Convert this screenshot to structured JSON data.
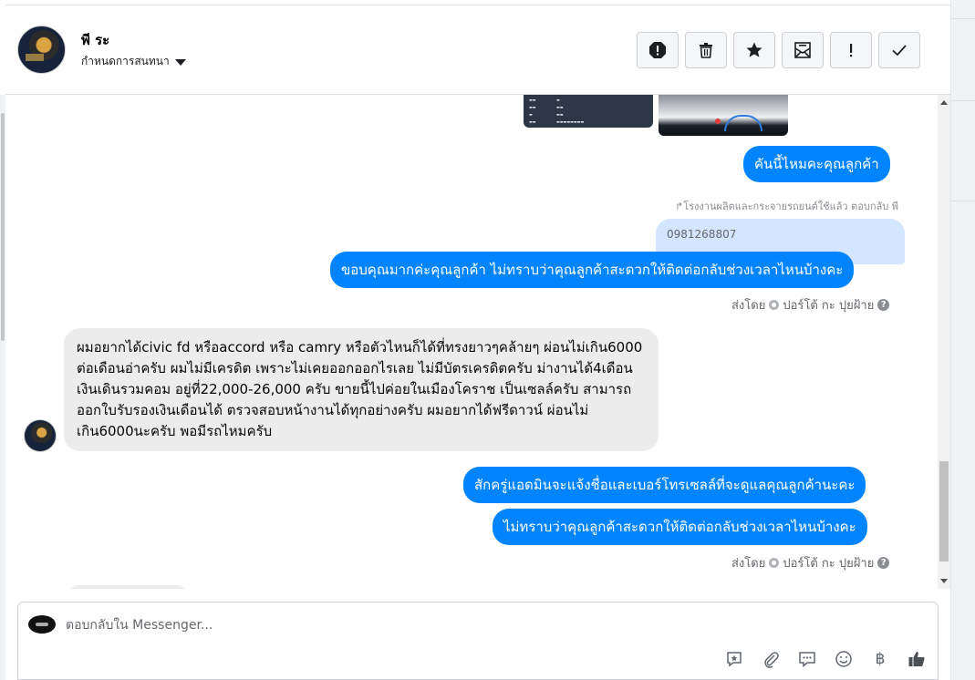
{
  "header": {
    "contact_name": "พี ระ",
    "assign_label": "กำหนดการสนทนา",
    "tools": [
      {
        "name": "report-icon"
      },
      {
        "name": "trash-icon"
      },
      {
        "name": "star-icon"
      },
      {
        "name": "mark-unread-icon"
      },
      {
        "name": "important-icon"
      },
      {
        "name": "check-icon"
      }
    ]
  },
  "messages": {
    "out_1": "คันนี้ไหมคะคุณลูกค้า",
    "reply_label": "โรงงานผลิตและกระจายรถยนต์ใช้แล้ว ตอบกลับ พี",
    "reply_quote": "0981268807",
    "out_2": "ขอบคุณมากค่ะคุณลูกค้า ไม่ทราบว่าคุณลูกค้าสะดวกให้ติดต่อกลับช่วงเวลาไหนบ้างคะ",
    "sent_by_1": "ส่งโดย",
    "sender_1": "ปอร์โต้ กะ ปุยฝ้าย",
    "in_1": "ผมอยากได้civic fd หรือaccord หรือ camry หรือตัวไหนก็ได้ที่ทรงยาวๆคล้ายๆ  ผ่อนไม่เกิน6000 ต่อเดือนอ่าครับ  ผมไม่มีเครดิต เพราะไม่เคยออกออกไรเลย ไม่มีบัตรเครดิตครับ  ม่างานได้4เดือน  เงินเดินรวมคอม อยู่ที่22,000-26,000 ครับ ขายนี้ไปค่อยในเมืองโคราช  เป็นเซลล์ครับ  สามารถออกใบรับรองเงินเดือนได้  ตรวจสอบหน้างานได้ทุกอย่างครับ  ผมอยากได้ฟรีดาวน์ ผ่อนไม่เกิน6000นะครับ  พอมีรถไหมครับ",
    "out_3": "สักครู่แอดมินจะแจ้งชื่อและเบอร์โทรเซลล์ที่จะดูแลคุณลูกค้านะคะ",
    "out_4": "ไม่ทราบว่าคุณลูกค้าสะดวกให้ติดต่อกลับช่วงเวลาไหนบ้างคะ",
    "sent_by_2": "ส่งโดย",
    "sender_2": "ปอร์โต้ กะ ปุยฝ้าย"
  },
  "composer": {
    "placeholder": "ตอบกลับใน Messenger...",
    "baht_symbol": "฿"
  },
  "colors": {
    "outgoing_bubble": "#0084ff",
    "incoming_bubble": "#ececec",
    "reply_quote_bg": "#d3e5ff"
  }
}
